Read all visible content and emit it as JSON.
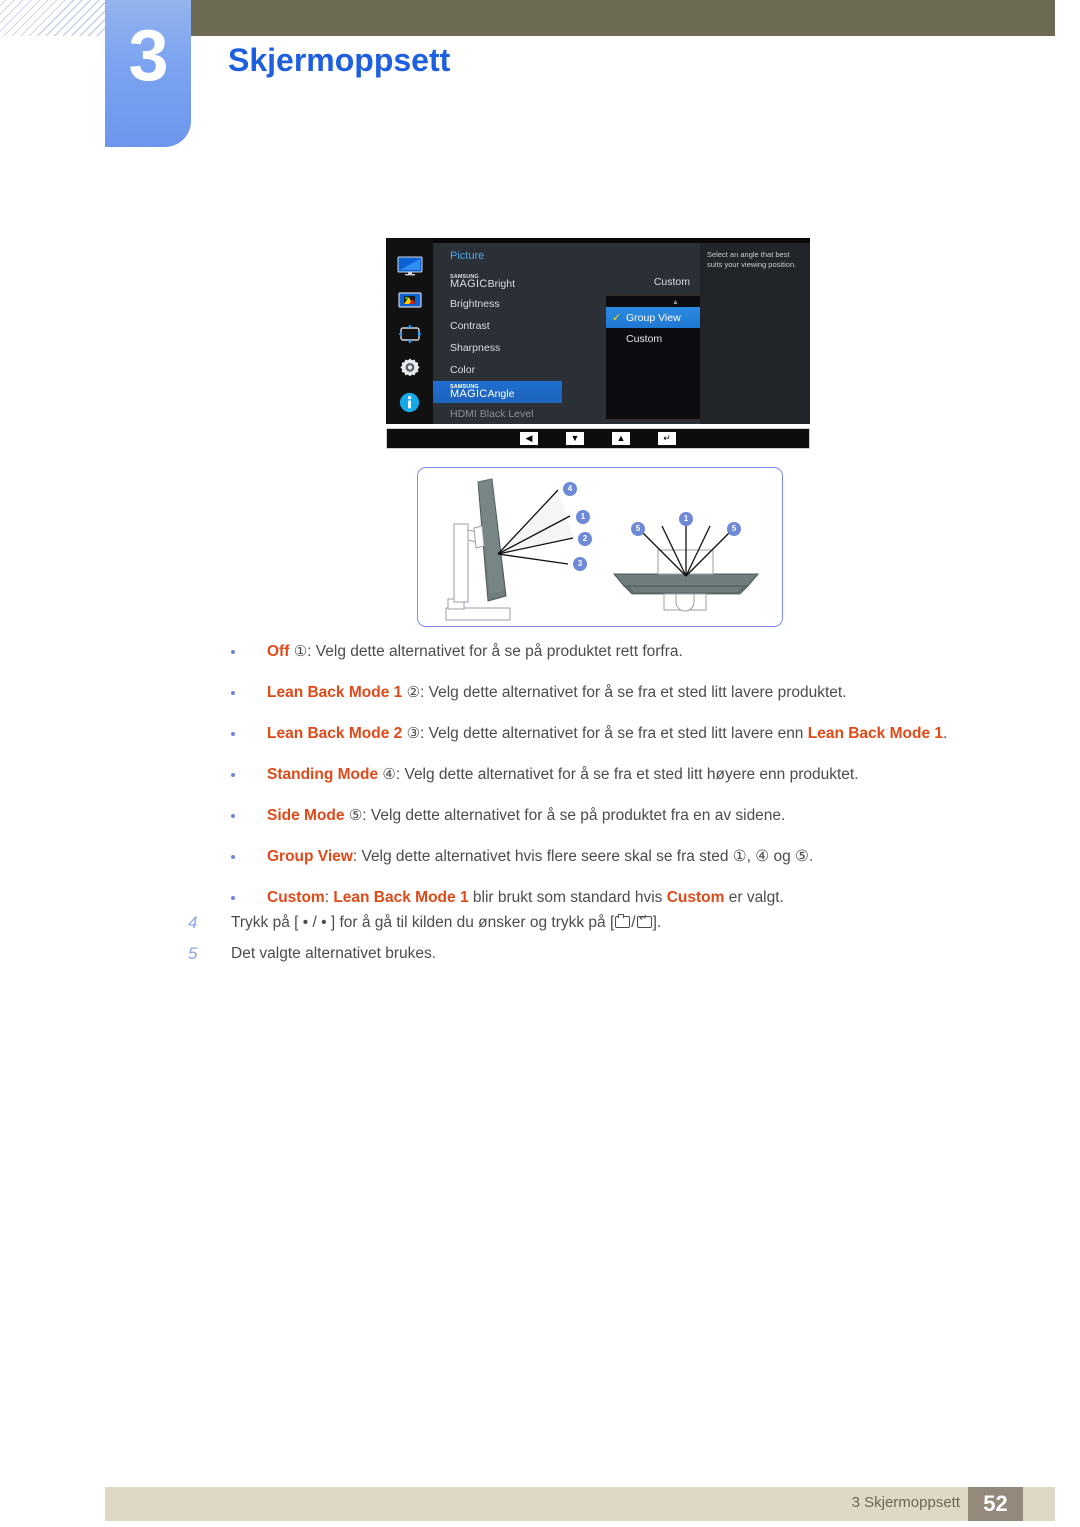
{
  "chapter": {
    "number": "3",
    "title": "Skjermoppsett"
  },
  "osd": {
    "menu_title": "Picture",
    "sidebar_icons": [
      "display-icon",
      "picture-icon",
      "onscreen-display-icon",
      "settings-gear-icon",
      "information-icon"
    ],
    "rows": [
      {
        "samsung": "SAMSUNG",
        "magic": "MAGIC",
        "suffix": "Bright",
        "label": "",
        "value": "Custom"
      },
      {
        "label": "Brightness",
        "value": ""
      },
      {
        "label": "Contrast",
        "value": ""
      },
      {
        "label": "Sharpness",
        "value": ""
      },
      {
        "label": "Color",
        "value": ""
      },
      {
        "samsung": "SAMSUNG",
        "magic": "MAGIC",
        "suffix": "Angle",
        "label": "",
        "value": ""
      },
      {
        "label": "HDMI Black Level",
        "value": ""
      }
    ],
    "submenu": {
      "scroll_arrow": "▲",
      "items": [
        {
          "label": "Group View",
          "checked": true
        },
        {
          "label": "Custom",
          "checked": false
        }
      ],
      "check_glyph": "✓"
    },
    "help_text": "Select an angle that best suits your viewing position.",
    "buttons": [
      {
        "name": "left-arrow-button",
        "glyph": "◀"
      },
      {
        "name": "down-arrow-button",
        "glyph": "▼"
      },
      {
        "name": "up-arrow-button",
        "glyph": "▲"
      },
      {
        "name": "enter-button",
        "glyph": "↵"
      }
    ]
  },
  "diagram": {
    "side_view_labels": [
      "4",
      "1",
      "2",
      "3"
    ],
    "top_view_labels": [
      "5",
      "1",
      "5"
    ]
  },
  "bullets": [
    {
      "term": "Off",
      "marker": "①",
      "rest": ": Velg dette alternativet for å se på produktet rett forfra."
    },
    {
      "term": "Lean Back Mode 1",
      "marker": "②",
      "rest": ": Velg dette alternativet for å se fra et sted litt lavere produktet."
    },
    {
      "term": "Lean Back Mode 2",
      "marker": "③",
      "rest": ": Velg dette alternativet for å se fra et sted litt lavere enn ",
      "tail_bold": "Lean Back Mode 1",
      "tail": "."
    },
    {
      "term": "Standing Mode",
      "marker": "④",
      "rest": ": Velg dette alternativet for å se fra et sted litt høyere enn produktet."
    },
    {
      "term": "Side Mode",
      "marker": "⑤",
      "rest": ": Velg dette alternativet for å se på produktet fra en av sidene."
    },
    {
      "term": "Group View",
      "marker": "",
      "rest": ": Velg dette alternativet hvis flere seere skal se fra sted ①, ④ og ⑤."
    },
    {
      "term": "Custom",
      "marker": "",
      "rest": ": ",
      "tail_bold": "Lean Back Mode 1",
      "tail": " blir brukt som standard hvis ",
      "tail_bold2": "Custom",
      "tail2": " er valgt."
    }
  ],
  "steps": [
    {
      "number": "4",
      "pre": "Trykk på [ • / • ] for å gå til kilden du ønsker og trykk på [",
      "post": "]."
    },
    {
      "number": "5",
      "pre": "Det valgte alternativet brukes.",
      "post": ""
    }
  ],
  "footer": {
    "text": "3 Skjermoppsett",
    "page": "52"
  },
  "colors": {
    "accent_blue": "#1e5fe0",
    "term_orange": "#e04a18",
    "header_olive": "#6d6a54",
    "footer_beige": "#ddd9c6",
    "page_box": "#95897c",
    "badge_blue": "#7ba3f0"
  }
}
